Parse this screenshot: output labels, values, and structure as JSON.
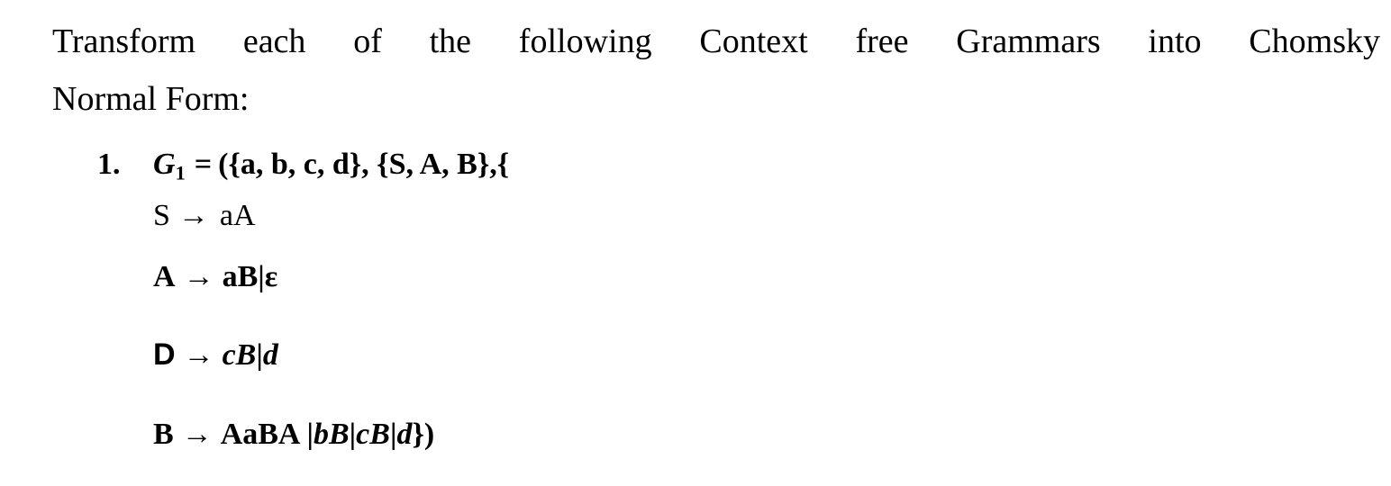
{
  "document": {
    "background_color": "#ffffff",
    "text_color": "#000000",
    "intro": {
      "line1": "Transform each of the following Context free Grammars into Chomsky",
      "line2": "Normal Form:",
      "full_text": "Transform each of the following Context free Grammars into Chomsky Normal Form:"
    },
    "list": {
      "items": [
        {
          "marker": "1.",
          "grammar_name": "G",
          "grammar_subscript": "1",
          "definition_equals": "=",
          "definition_tail": "({a, b, c, d}, {S, A, B},{",
          "definition_full": "G1 = ({a, b, c, d}, {S, A, B},{",
          "terminals": [
            "a",
            "b",
            "c",
            "d"
          ],
          "nonterminals": [
            "S",
            "A",
            "B"
          ],
          "productions": [
            {
              "lhs": "S",
              "arrow": "→",
              "rhs": "aA",
              "rhs_plain": "aA",
              "weight": "regular",
              "lhs_font": "serif"
            },
            {
              "lhs": "A",
              "arrow": "→",
              "rhs_upright": "aB",
              "rhs_separator": "|",
              "rhs_epsilon": "ε",
              "rhs_plain": "aB|ε",
              "weight": "bold",
              "lhs_font": "serif"
            },
            {
              "lhs": "D",
              "arrow": "→",
              "rhs_italic_1": "cB",
              "rhs_separator": "|",
              "rhs_italic_2": "d",
              "rhs_plain": "cB|d",
              "weight": "bold",
              "lhs_font": "sans-serif"
            },
            {
              "lhs": "B",
              "arrow": "→",
              "rhs_upright": "AaBA",
              "sep1": "|",
              "alt1": "bB",
              "sep2": "|",
              "alt2": "cB",
              "sep3": "|",
              "alt3": "d",
              "closing": "})",
              "rhs_plain": "AaBA |bB|cB|d})",
              "weight": "bold",
              "lhs_font": "serif"
            }
          ]
        }
      ]
    }
  }
}
